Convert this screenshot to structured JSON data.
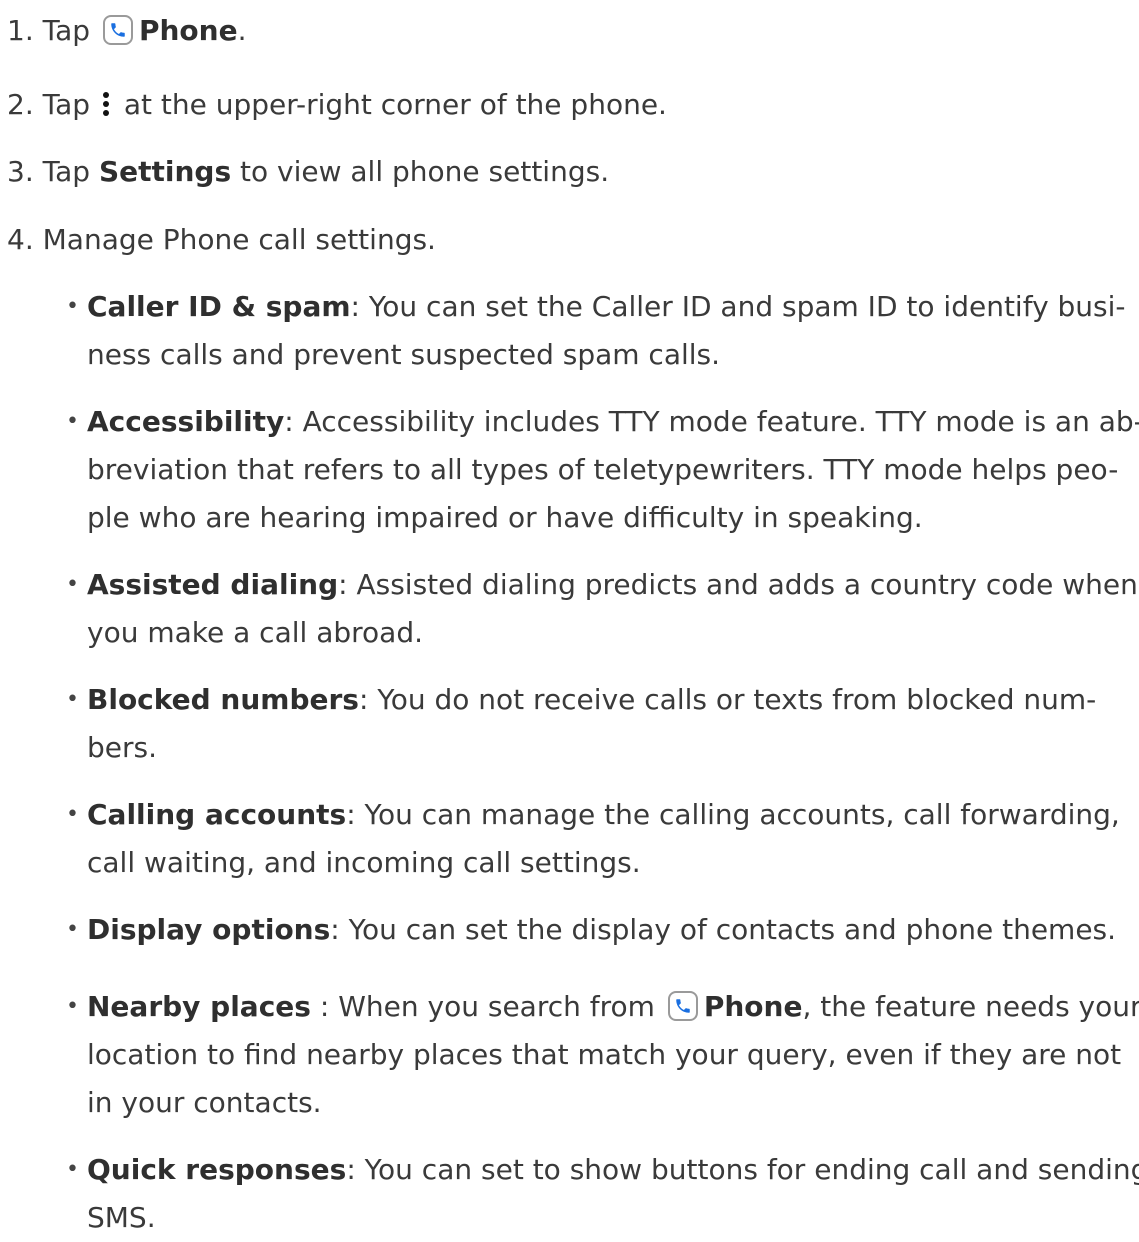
{
  "steps": [
    {
      "num": "1.",
      "pre": "Tap ",
      "bold": "Phone",
      "post": "."
    },
    {
      "num": "2.",
      "pre": "Tap ",
      "post": " at the upper-right corner of the phone."
    },
    {
      "num": "3.",
      "pre": "Tap ",
      "bold": "Settings",
      "post": " to view all phone settings."
    },
    {
      "num": "4.",
      "pre": "Manage Phone call settings."
    }
  ],
  "bullets": [
    {
      "term": "Caller ID & spam",
      "lines": [
        ": You can set the Caller ID and spam ID to identify busi-",
        "ness calls and prevent suspected spam calls."
      ]
    },
    {
      "term": "Accessibility",
      "lines": [
        ": Accessibility includes TTY mode feature. TTY mode is an ab-",
        "breviation that refers to all types of teletypewriters. TTY mode helps peo-",
        "ple who are hearing impaired or have difficulty in speaking."
      ]
    },
    {
      "term": "Assisted dialing",
      "lines": [
        ": Assisted dialing predicts and adds a country code when",
        "you make a call abroad."
      ]
    },
    {
      "term": "Blocked numbers",
      "lines": [
        ": You do not receive calls or texts from blocked num-",
        "bers."
      ]
    },
    {
      "term": "Calling accounts",
      "lines": [
        ": You can manage the calling accounts, call forwarding,",
        "call waiting, and incoming call settings."
      ]
    },
    {
      "term": "Display options",
      "lines": [
        ": You can set the display of contacts and phone themes."
      ]
    },
    {
      "term": "Nearby places",
      "pre_icon": " : When you search from ",
      "icon_bold": "Phone",
      "lines": [
        ", the feature needs your",
        "location to find nearby places that match your query, even if they are not",
        "in your contacts."
      ]
    },
    {
      "term": "Quick responses",
      "lines": [
        ": You can set to show buttons for ending call and sending",
        "SMS."
      ]
    }
  ],
  "icons": {
    "phone": "phone-app-icon",
    "more": "more-vert-icon",
    "phone_color": "#1a6fe0"
  }
}
